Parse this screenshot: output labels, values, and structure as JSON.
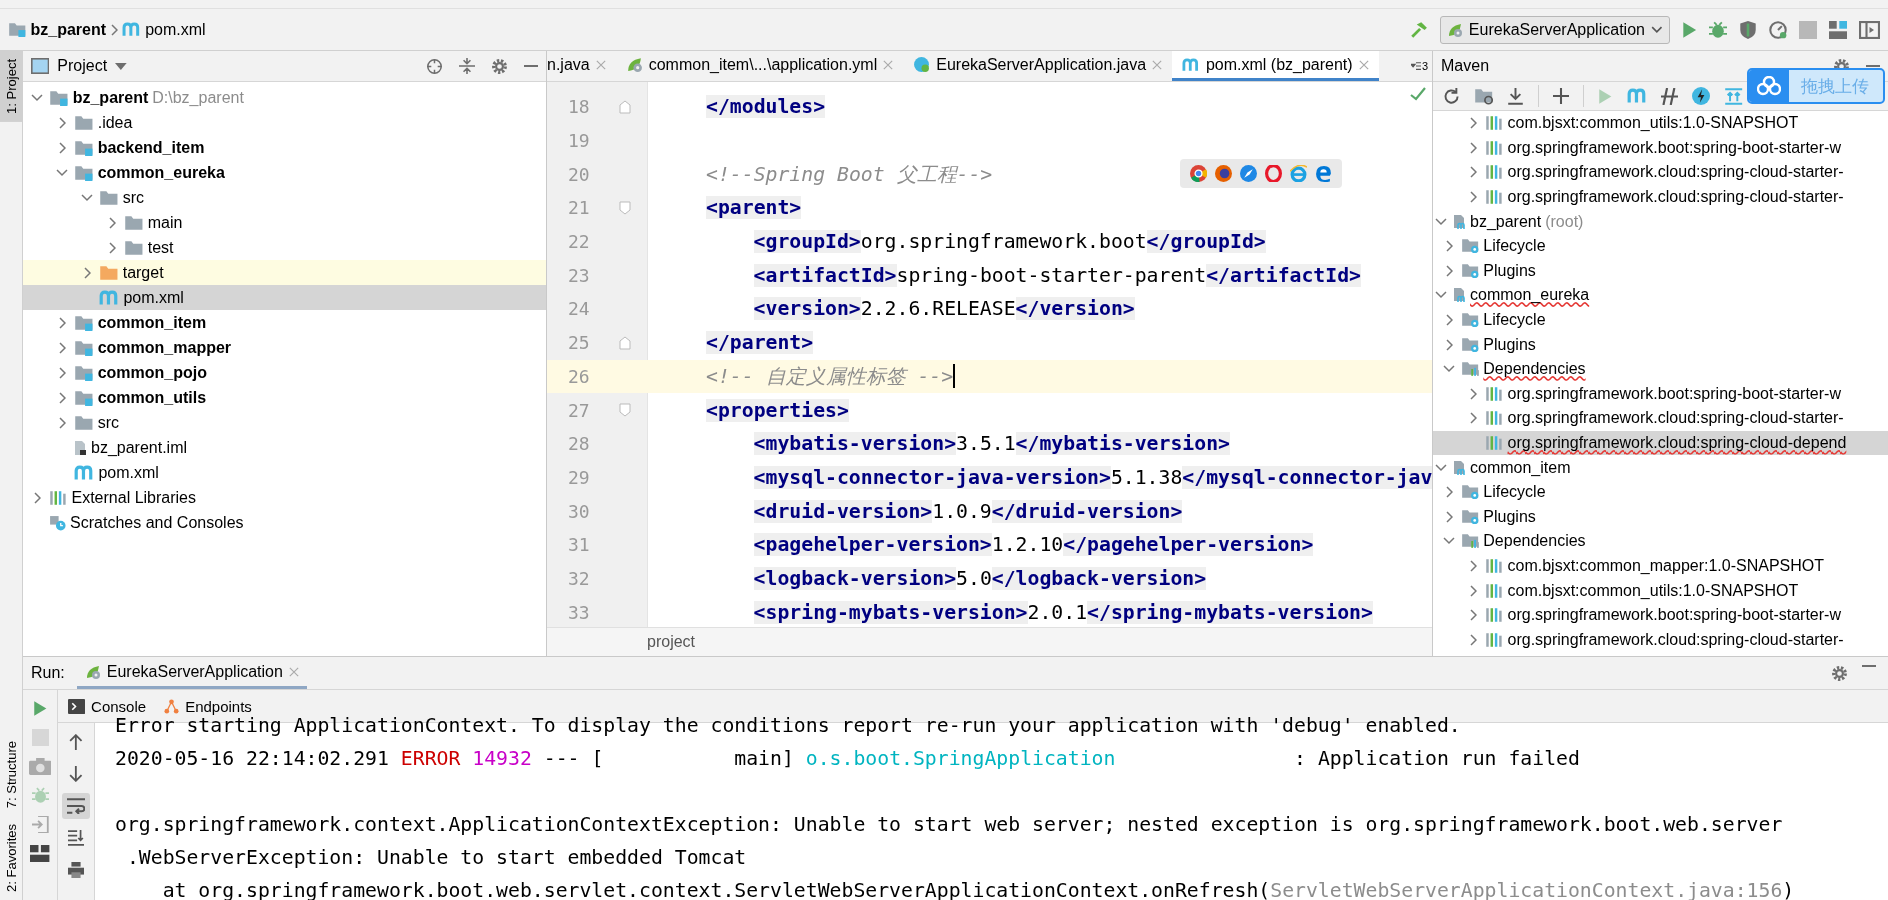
{
  "nav_bar": {
    "breadcrumbs": [
      {
        "label": "bz_parent",
        "kind": "module"
      },
      {
        "label": "pom.xml",
        "kind": "maven"
      }
    ],
    "run_config": "EurekaServerApplication"
  },
  "tool_strip": {
    "top": [
      {
        "label": "1: Project",
        "selected": true
      }
    ],
    "bottom": [
      {
        "label": "7: Structure",
        "selected": false
      },
      {
        "label": "2: Favorites",
        "selected": false
      }
    ]
  },
  "project_panel": {
    "title": "Project",
    "tree": [
      {
        "label": "bz_parent",
        "hint": "D:\\bz_parent",
        "kind": "module",
        "expanded": true,
        "selected": false,
        "highlighted": false,
        "children": [
          {
            "label": ".idea",
            "kind": "folder",
            "expanded": false,
            "selected": false,
            "highlighted": false
          },
          {
            "label": "backend_item",
            "kind": "module",
            "expanded": false,
            "selected": false,
            "highlighted": false
          },
          {
            "label": "common_eureka",
            "kind": "module",
            "expanded": true,
            "selected": false,
            "highlighted": false,
            "children": [
              {
                "label": "src",
                "kind": "folder",
                "expanded": true,
                "selected": false,
                "highlighted": false,
                "children": [
                  {
                    "label": "main",
                    "kind": "folder",
                    "expanded": false,
                    "selected": false,
                    "highlighted": false
                  },
                  {
                    "label": "test",
                    "kind": "folder",
                    "expanded": false,
                    "selected": false,
                    "highlighted": false
                  }
                ]
              },
              {
                "label": "target",
                "kind": "excluded-folder",
                "expanded": false,
                "selected": false,
                "highlighted": true
              },
              {
                "label": "pom.xml",
                "kind": "maven",
                "selected": true,
                "highlighted": false
              }
            ]
          },
          {
            "label": "common_item",
            "kind": "module",
            "expanded": false,
            "selected": false,
            "highlighted": false
          },
          {
            "label": "common_mapper",
            "kind": "module",
            "expanded": false,
            "selected": false,
            "highlighted": false
          },
          {
            "label": "common_pojo",
            "kind": "module",
            "expanded": false,
            "selected": false,
            "highlighted": false
          },
          {
            "label": "common_utils",
            "kind": "module",
            "expanded": false,
            "selected": false,
            "highlighted": false
          },
          {
            "label": "src",
            "kind": "folder",
            "expanded": false,
            "selected": false,
            "highlighted": false
          },
          {
            "label": "bz_parent.iml",
            "kind": "iml",
            "selected": false,
            "highlighted": false
          },
          {
            "label": "pom.xml",
            "kind": "maven",
            "selected": false,
            "highlighted": false
          }
        ]
      },
      {
        "label": "External Libraries",
        "kind": "libraries",
        "expanded": false,
        "selected": false,
        "highlighted": false
      },
      {
        "label": "Scratches and Consoles",
        "kind": "scratches",
        "selected": false,
        "highlighted": false
      }
    ]
  },
  "editor": {
    "tabs": [
      {
        "label": "n.java",
        "selected": false
      },
      {
        "label": "common_item\\...\\application.yml",
        "kind": "spring-config",
        "selected": false
      },
      {
        "label": "EurekaServerApplication.java",
        "kind": "java-class",
        "selected": false
      },
      {
        "label": "pom.xml (bz_parent)",
        "kind": "maven",
        "selected": true
      }
    ],
    "hidden_tab_count": "3",
    "lines": [
      {
        "number": "18",
        "kind": "fold-end",
        "current": false,
        "segments": [
          {
            "text": "</modules>",
            "kind": "tag"
          }
        ]
      },
      {
        "number": "19",
        "current": false
      },
      {
        "number": "20",
        "current": false,
        "segments": [
          {
            "text": "<!--Spring Boot 父工程-->",
            "kind": "comment"
          }
        ]
      },
      {
        "number": "21",
        "kind": "fold-start",
        "current": false,
        "segments": [
          {
            "text": "<parent>",
            "kind": "tag"
          }
        ],
        "children": [
          {
            "number": "22",
            "current": false,
            "segments": [
              {
                "text": "<groupId>",
                "kind": "tag"
              },
              {
                "text": "org.springframework.boot",
                "kind": "text"
              },
              {
                "text": "</groupId>",
                "kind": "tag"
              }
            ]
          },
          {
            "number": "23",
            "current": false,
            "segments": [
              {
                "text": "<artifactId>",
                "kind": "tag"
              },
              {
                "text": "spring-boot-starter-parent",
                "kind": "text"
              },
              {
                "text": "</artifactId>",
                "kind": "tag"
              }
            ]
          },
          {
            "number": "24",
            "current": false,
            "segments": [
              {
                "text": "<version>",
                "kind": "tag"
              },
              {
                "text": "2.2.6.RELEASE",
                "kind": "text"
              },
              {
                "text": "</version>",
                "kind": "tag"
              }
            ]
          }
        ]
      },
      {
        "number": "25",
        "kind": "fold-end",
        "current": false,
        "segments": [
          {
            "text": "</parent>",
            "kind": "tag"
          }
        ]
      },
      {
        "number": "26",
        "current": true,
        "segments": [
          {
            "text": "<!-- 自定义属性标签 -->",
            "kind": "comment"
          }
        ]
      },
      {
        "number": "27",
        "kind": "fold-start",
        "current": false,
        "segments": [
          {
            "text": "<properties>",
            "kind": "tag"
          }
        ],
        "children": [
          {
            "number": "28",
            "current": false,
            "segments": [
              {
                "text": "<mybatis-version>",
                "kind": "tag"
              },
              {
                "text": "3.5.1",
                "kind": "text"
              },
              {
                "text": "</mybatis-version>",
                "kind": "tag"
              }
            ]
          },
          {
            "number": "29",
            "current": false,
            "segments": [
              {
                "text": "<mysql-connector-java-version>",
                "kind": "tag"
              },
              {
                "text": "5.1.38",
                "kind": "text"
              },
              {
                "text": "</mysql-connector-jav",
                "kind": "tag"
              }
            ]
          },
          {
            "number": "30",
            "current": false,
            "segments": [
              {
                "text": "<druid-version>",
                "kind": "tag"
              },
              {
                "text": "1.0.9",
                "kind": "text"
              },
              {
                "text": "</druid-version>",
                "kind": "tag"
              }
            ]
          },
          {
            "number": "31",
            "current": false,
            "segments": [
              {
                "text": "<pagehelper-version>",
                "kind": "tag"
              },
              {
                "text": "1.2.10",
                "kind": "text"
              },
              {
                "text": "</pagehelper-version>",
                "kind": "tag"
              }
            ]
          },
          {
            "number": "32",
            "current": false,
            "segments": [
              {
                "text": "<logback-version>",
                "kind": "tag"
              },
              {
                "text": "5.0",
                "kind": "text"
              },
              {
                "text": "</logback-version>",
                "kind": "tag"
              }
            ]
          },
          {
            "number": "33",
            "current": false,
            "segments": [
              {
                "text": "<spring-mybats-version>",
                "kind": "tag"
              },
              {
                "text": "2.0.1",
                "kind": "text"
              },
              {
                "text": "</spring-mybats-version>",
                "kind": "tag"
              }
            ]
          }
        ]
      }
    ],
    "breadcrumb": "project"
  },
  "upload_button": {
    "label": "拖拽上传"
  },
  "maven_panel": {
    "title": "Maven",
    "tree": [
      {
        "children": [
          {
            "children": [
              {
                "label": "com.bjsxt:common_utils:1.0-SNAPSHOT",
                "kind": "dependency",
                "expanded": false,
                "selected": false,
                "error": false
              },
              {
                "label": "org.springframework.boot:spring-boot-starter-w",
                "kind": "dependency",
                "expanded": false,
                "selected": false,
                "error": false
              },
              {
                "label": "org.springframework.cloud:spring-cloud-starter-",
                "kind": "dependency",
                "expanded": false,
                "selected": false,
                "error": false
              },
              {
                "label": "org.springframework.cloud:spring-cloud-starter-",
                "kind": "dependency",
                "expanded": false,
                "selected": false,
                "error": false
              }
            ]
          }
        ]
      },
      {
        "label": "bz_parent",
        "hint": "(root)",
        "kind": "project",
        "expanded": true,
        "selected": false,
        "error": false,
        "children": [
          {
            "label": "Lifecycle",
            "kind": "lifecycle",
            "expanded": false,
            "selected": false,
            "error": false
          },
          {
            "label": "Plugins",
            "kind": "lifecycle",
            "expanded": false,
            "selected": false,
            "error": false
          }
        ]
      },
      {
        "label": "common_eureka",
        "kind": "project",
        "expanded": true,
        "selected": false,
        "error": true,
        "children": [
          {
            "label": "Lifecycle",
            "kind": "lifecycle",
            "expanded": false,
            "selected": false,
            "error": false
          },
          {
            "label": "Plugins",
            "kind": "lifecycle",
            "expanded": false,
            "selected": false,
            "error": false
          },
          {
            "label": "Dependencies",
            "kind": "dependencies",
            "expanded": true,
            "selected": false,
            "error": true,
            "children": [
              {
                "label": "org.springframework.boot:spring-boot-starter-w",
                "kind": "dependency",
                "expanded": false,
                "selected": false,
                "error": false
              },
              {
                "label": "org.springframework.cloud:spring-cloud-starter-",
                "kind": "dependency",
                "expanded": false,
                "selected": false,
                "error": false
              },
              {
                "label": "org.springframework.cloud:spring-cloud-depend",
                "kind": "dependency",
                "selected": true,
                "error": true
              }
            ]
          }
        ]
      },
      {
        "label": "common_item",
        "kind": "project",
        "expanded": true,
        "selected": false,
        "error": false,
        "children": [
          {
            "label": "Lifecycle",
            "kind": "lifecycle",
            "expanded": false,
            "selected": false,
            "error": false
          },
          {
            "label": "Plugins",
            "kind": "lifecycle",
            "expanded": false,
            "selected": false,
            "error": false
          },
          {
            "label": "Dependencies",
            "kind": "dependencies",
            "expanded": true,
            "selected": false,
            "error": false,
            "children": [
              {
                "label": "com.bjsxt:common_mapper:1.0-SNAPSHOT",
                "kind": "dependency",
                "expanded": false,
                "selected": false,
                "error": false
              },
              {
                "label": "com.bjsxt:common_utils:1.0-SNAPSHOT",
                "kind": "dependency",
                "expanded": false,
                "selected": false,
                "error": false
              },
              {
                "label": "org.springframework.boot:spring-boot-starter-w",
                "kind": "dependency",
                "expanded": false,
                "selected": false,
                "error": false
              },
              {
                "label": "org.springframework.cloud:spring-cloud-starter-",
                "kind": "dependency",
                "expanded": false,
                "selected": false,
                "error": false
              }
            ]
          }
        ]
      }
    ]
  },
  "run_panel": {
    "label": "Run:",
    "tabs": [
      {
        "label": "EurekaServerApplication",
        "selected": true
      }
    ],
    "console_tabs": [
      {
        "label": "Console",
        "kind": "console"
      },
      {
        "label": "Endpoints",
        "kind": "endpoints"
      }
    ],
    "side_tools": [
      {
        "kind": "run",
        "disabled": false
      },
      {
        "kind": "stop",
        "disabled": true
      },
      {
        "kind": "camera",
        "disabled": true
      },
      {
        "kind": "bug",
        "disabled": true
      },
      {
        "kind": "enter",
        "disabled": true
      },
      {
        "kind": "layout",
        "disabled": false
      }
    ],
    "console_tools": [
      {
        "kind": "up",
        "on": false
      },
      {
        "kind": "down",
        "on": false
      },
      {
        "kind": "wrap",
        "on": true
      },
      {
        "kind": "scroll-end",
        "on": false
      },
      {
        "kind": "print",
        "on": false
      }
    ],
    "console_blocks": [
      {
        "lines": [
          {
            "segments": [
              {
                "text": "Error starting ApplicationContext. To display the conditions report re-run your application with 'debug' enabled.",
                "kind": "plain"
              }
            ]
          },
          {
            "segments": [
              {
                "text": "2020-05-16 22:14:02.291 ",
                "kind": "plain"
              },
              {
                "text": "ERROR",
                "kind": "error"
              },
              {
                "text": " 14932",
                "kind": "pid"
              },
              {
                "text": " --- [           main] ",
                "kind": "plain"
              },
              {
                "text": "o.s.boot.SpringApplication",
                "kind": "logger"
              },
              {
                "text": "               : Application run failed",
                "kind": "plain"
              }
            ]
          }
        ]
      },
      {
        "lines": [
          {
            "segments": [
              {
                "text": "org.springframework.context.ApplicationContextException: Unable to start web server; nested exception is org.springframework.boot.web.server",
                "kind": "plain"
              }
            ]
          },
          {
            "segments": [
              {
                "text": " .WebServerException: Unable to start embedded Tomcat",
                "kind": "plain"
              }
            ]
          },
          {
            "segments": [
              {
                "text": "    at org.springframework.boot.web.servlet.context.ServletWebServerApplicationContext.onRefresh(",
                "kind": "plain"
              },
              {
                "text": "ServletWebServerApplicationContext.java:156",
                "kind": "file-ref"
              },
              {
                "text": ")",
                "kind": "plain"
              }
            ]
          }
        ]
      }
    ]
  }
}
